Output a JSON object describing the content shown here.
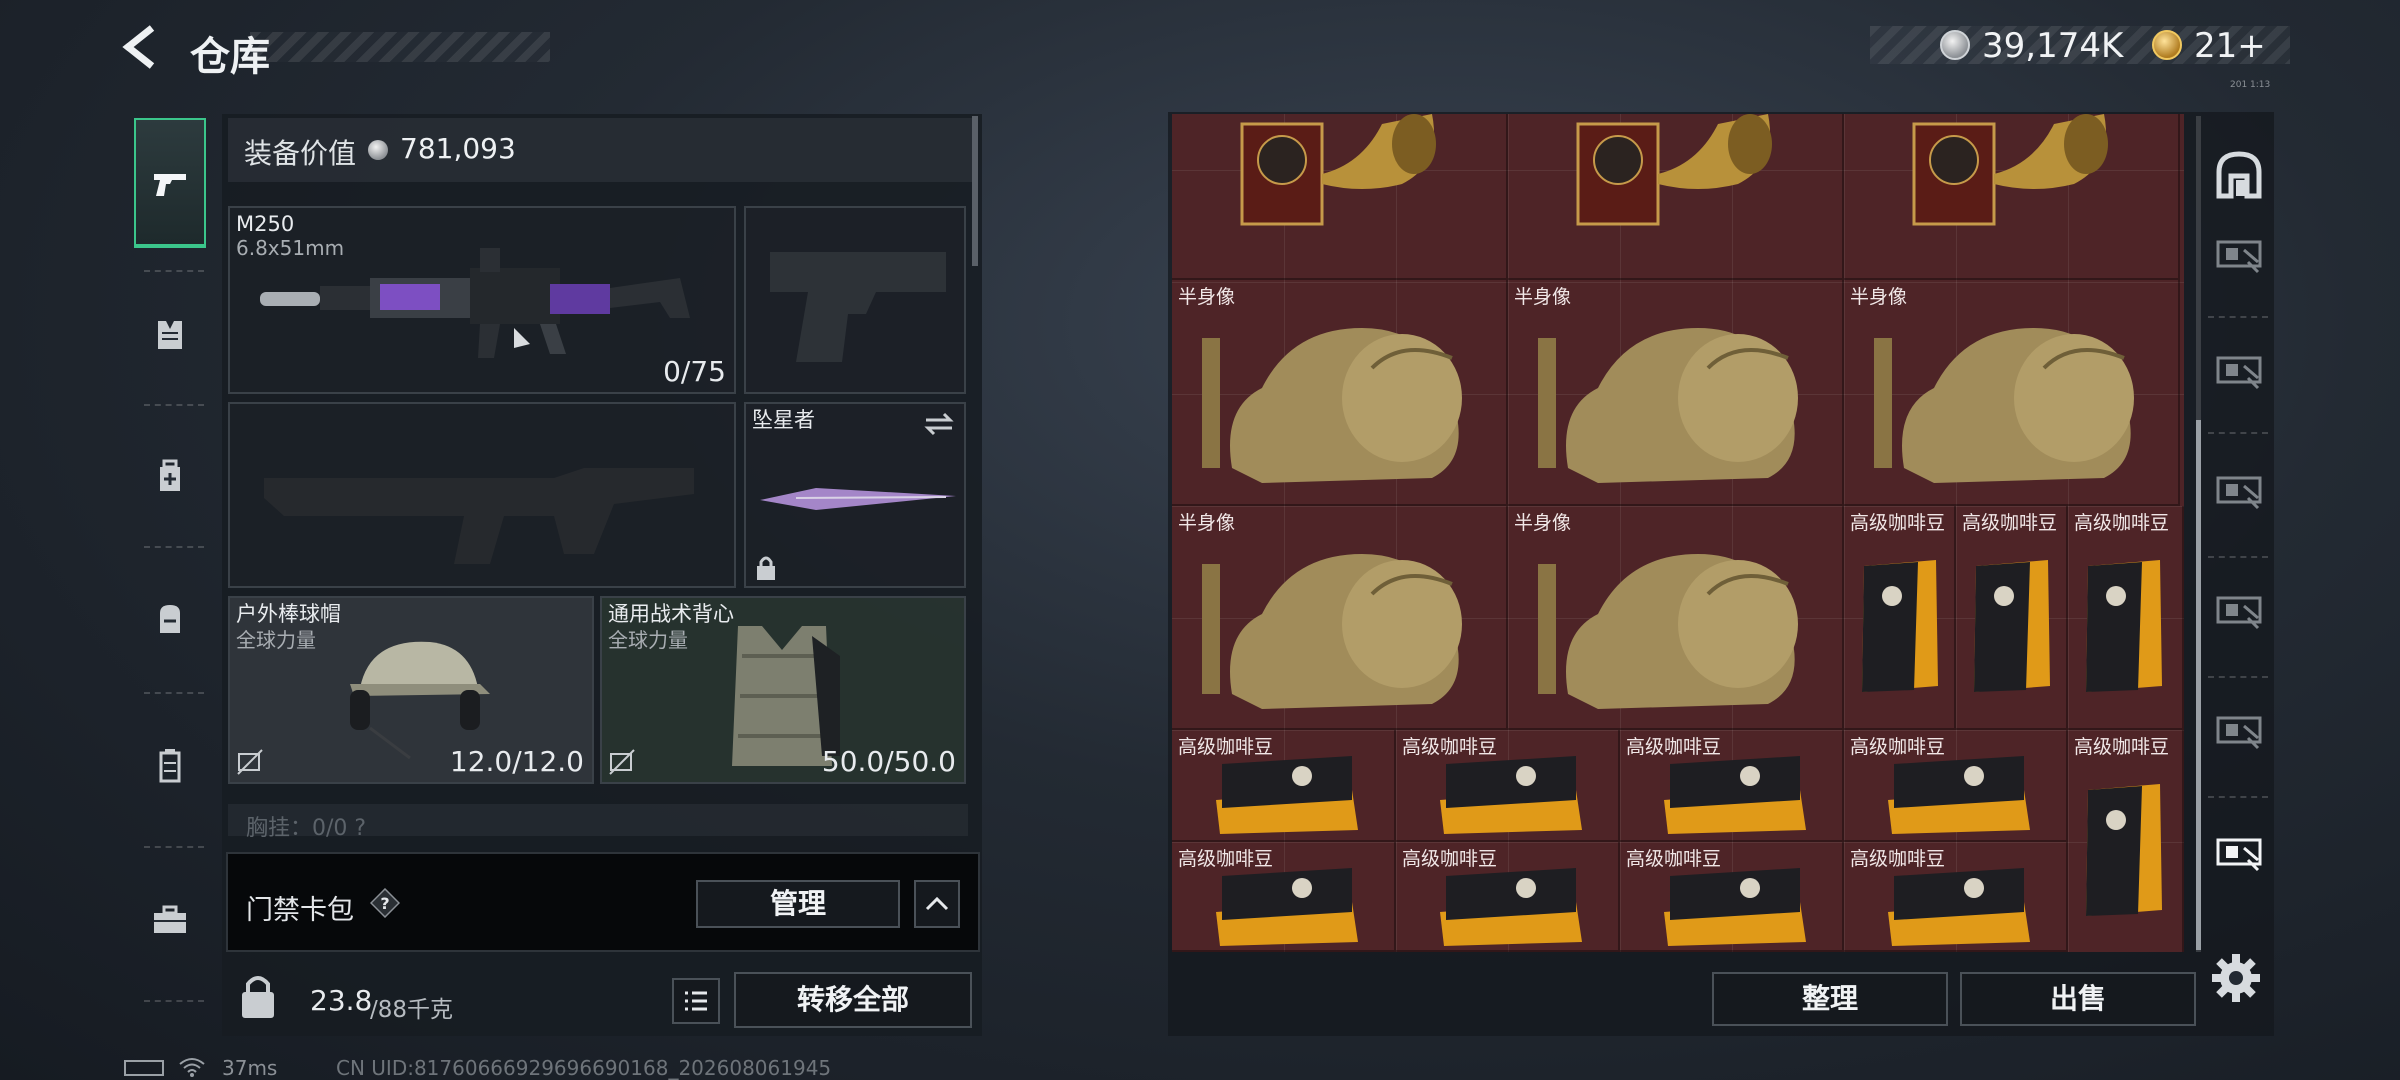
{
  "header": {
    "title": "仓库",
    "currency_silver": "39,174K",
    "currency_gold": "21+",
    "tiny_info": "201 1:13"
  },
  "category_rail": [
    {
      "id": "weapons",
      "icon": "pistol-icon",
      "active": true
    },
    {
      "id": "armor",
      "icon": "vest-icon",
      "active": false
    },
    {
      "id": "medical",
      "icon": "medkit-icon",
      "active": false
    },
    {
      "id": "backpack",
      "icon": "backpack-icon",
      "active": false
    },
    {
      "id": "container",
      "icon": "canister-icon",
      "active": false
    },
    {
      "id": "case",
      "icon": "briefcase-icon",
      "active": false
    }
  ],
  "loadout": {
    "equipment_value_label": "装备价值",
    "equipment_value": "781,093",
    "primary": {
      "name": "M250",
      "caliber": "6.8x51mm",
      "ammo": "0/75"
    },
    "sidearm": {
      "empty": true
    },
    "secondary": {
      "empty": true
    },
    "melee": {
      "name": "坠星者"
    },
    "helmet": {
      "name": "户外棒球帽",
      "faction": "全球力量",
      "durability": "12.0/12.0"
    },
    "armor": {
      "name": "通用战术背心",
      "faction": "全球力量",
      "durability": "50.0/50.0"
    },
    "chest_rig_partial": "胸挂：0/0  ?",
    "keycard_label": "门禁卡包",
    "manage_label": "管理",
    "weight_current": "23.8",
    "weight_max": "/88千克",
    "transfer_all_label": "转移全部"
  },
  "storage": {
    "items": [
      {
        "label": "",
        "kind": "gramophone"
      },
      {
        "label": "",
        "kind": "gramophone"
      },
      {
        "label": "",
        "kind": "gramophone"
      },
      {
        "label": "半身像",
        "kind": "bust"
      },
      {
        "label": "半身像",
        "kind": "bust"
      },
      {
        "label": "半身像",
        "kind": "bust"
      },
      {
        "label": "半身像",
        "kind": "bust"
      },
      {
        "label": "半身像",
        "kind": "bust"
      },
      {
        "label": "高级咖啡豆",
        "kind": "coffee-tall"
      },
      {
        "label": "高级咖啡豆",
        "kind": "coffee-tall"
      },
      {
        "label": "高级咖啡豆",
        "kind": "coffee-tall"
      },
      {
        "label": "高级咖啡豆",
        "kind": "coffee-flat"
      },
      {
        "label": "高级咖啡豆",
        "kind": "coffee-flat"
      },
      {
        "label": "高级咖啡豆",
        "kind": "coffee-flat"
      },
      {
        "label": "高级咖啡豆",
        "kind": "coffee-flat"
      },
      {
        "label": "高级咖啡豆",
        "kind": "coffee-tall"
      },
      {
        "label": "高级咖啡豆",
        "kind": "coffee-flat"
      },
      {
        "label": "高级咖啡豆",
        "kind": "coffee-flat"
      },
      {
        "label": "高级咖啡豆",
        "kind": "coffee-flat"
      },
      {
        "label": "高级咖啡豆",
        "kind": "coffee-flat"
      }
    ],
    "arrange_label": "整理",
    "sell_label": "出售"
  },
  "right_rail": [
    {
      "icon": "safehouse-icon"
    },
    {
      "icon": "storage-tab-icon"
    },
    {
      "icon": "storage-tab-icon"
    },
    {
      "icon": "storage-tab-icon"
    },
    {
      "icon": "storage-tab-icon"
    },
    {
      "icon": "storage-tab-icon"
    },
    {
      "icon": "storage-tab-icon",
      "active": true
    },
    {
      "icon": "gear-icon"
    }
  ],
  "status": {
    "ping": "37ms",
    "uid": "CN UID:81760666929696690168_202608061945"
  },
  "colors": {
    "accent_green": "#3bc68b",
    "grid_bg": "#4e2427"
  }
}
